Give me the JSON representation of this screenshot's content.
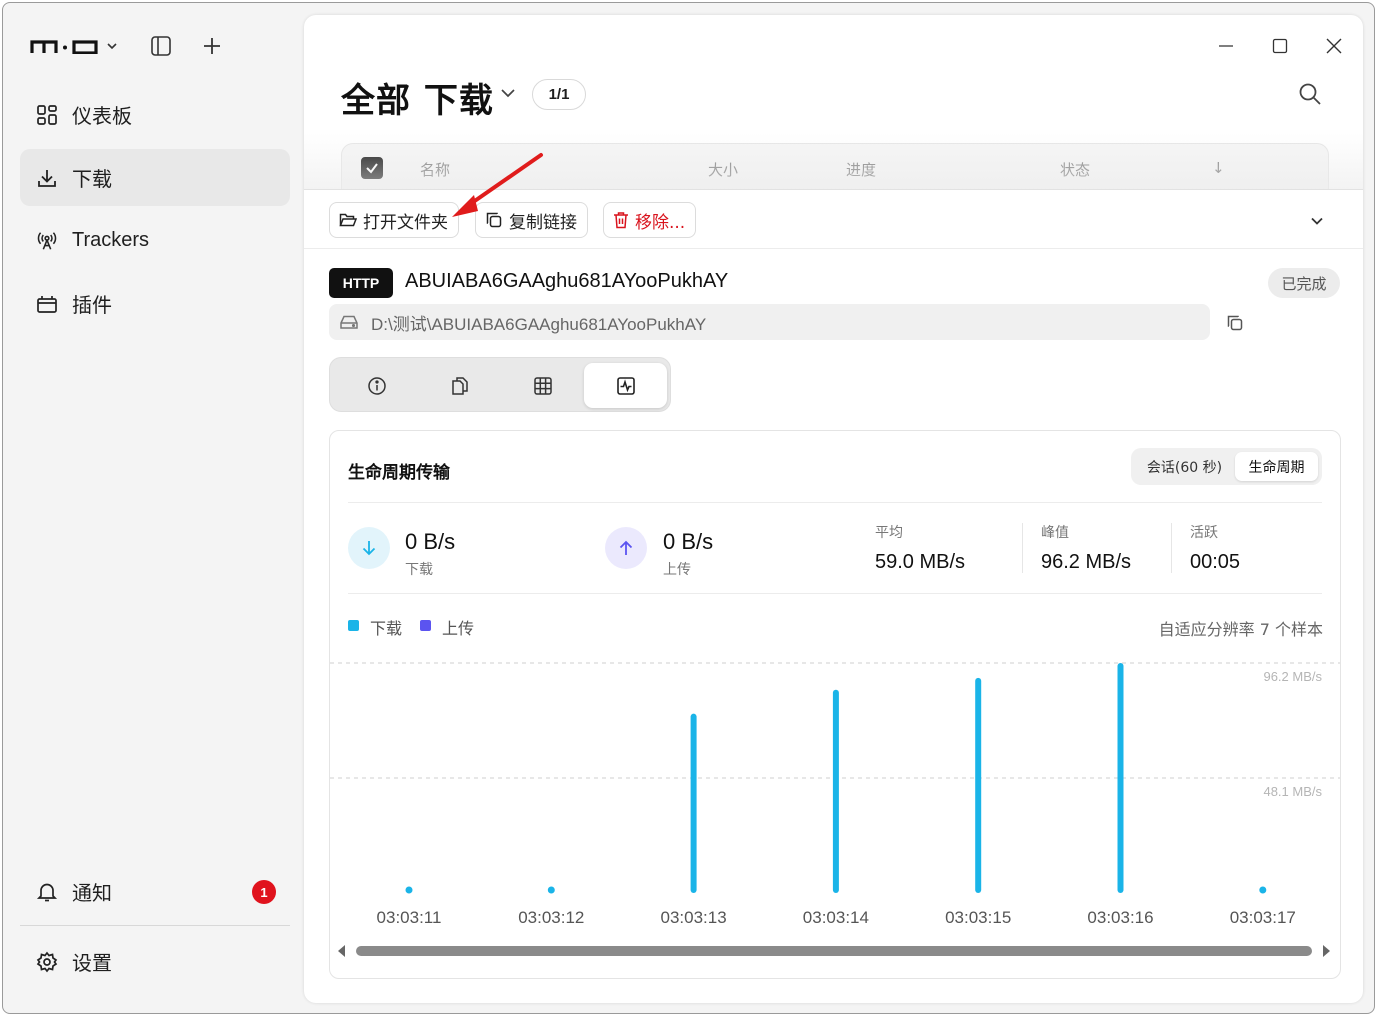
{
  "app": {
    "logo_text": "m·o"
  },
  "sidebar": {
    "items": [
      {
        "label": "仪表板",
        "icon": "dashboard-icon"
      },
      {
        "label": "下载",
        "icon": "download-icon",
        "active": true
      },
      {
        "label": "Trackers",
        "icon": "antenna-icon"
      },
      {
        "label": "插件",
        "icon": "plugin-icon"
      }
    ],
    "notifications": {
      "label": "通知",
      "count": "1"
    },
    "settings": {
      "label": "设置"
    }
  },
  "header": {
    "title": "全部 下载",
    "count": "1/1"
  },
  "table": {
    "columns": [
      "名称",
      "大小",
      "进度",
      "状态",
      "↓"
    ]
  },
  "actions": {
    "open_folder": "打开文件夹",
    "copy_link": "复制链接",
    "remove": "移除..."
  },
  "detail": {
    "protocol": "HTTP",
    "filename": "ABUIABA6GAAghu681AYooPukhAY",
    "status": "已完成",
    "path": "D:\\测试\\ABUIABA6GAAghu681AYooPukhAY",
    "tabs": [
      "info-icon",
      "files-icon",
      "pieces-icon",
      "activity-icon"
    ],
    "active_tab": 3
  },
  "transfer": {
    "title": "生命周期传输",
    "range_options": [
      "会话(60 秒)",
      "生命周期"
    ],
    "active_range": "生命周期",
    "download_rate": "0 B/s",
    "download_label": "下载",
    "upload_rate": "0 B/s",
    "upload_label": "上传",
    "stats": {
      "avg_label": "平均",
      "avg_value": "59.0 MB/s",
      "peak_label": "峰值",
      "peak_value": "96.2 MB/s",
      "active_label": "活跃",
      "active_value": "00:05"
    },
    "legend": [
      "下载",
      "上传"
    ],
    "sample_note": "自适应分辨率 7 个样本"
  },
  "colors": {
    "download": "#1ab4e8",
    "upload": "#5b54f0",
    "badge_red": "#e0131d",
    "danger": "#d9131d"
  },
  "chart_data": {
    "type": "bar",
    "categories": [
      "03:03:11",
      "03:03:12",
      "03:03:13",
      "03:03:14",
      "03:03:15",
      "03:03:16",
      "03:03:17"
    ],
    "series": [
      {
        "name": "下载",
        "values": [
          0,
          0,
          75,
          85,
          90,
          96.2,
          0
        ]
      },
      {
        "name": "上传",
        "values": [
          0,
          0,
          0,
          0,
          0,
          0,
          0
        ]
      }
    ],
    "y_ticks": [
      "96.2 MB/s",
      "48.1 MB/s"
    ],
    "y_tick_values": [
      96.2,
      48.1
    ],
    "ylim": [
      0,
      96.2
    ],
    "grid": "dashed"
  }
}
